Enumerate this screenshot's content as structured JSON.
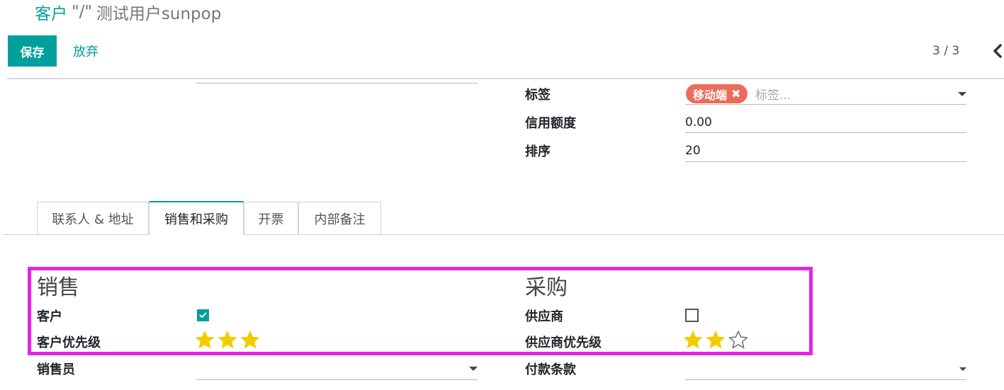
{
  "breadcrumb": {
    "parent": "客户",
    "separator": "\"/\"",
    "current": "测试用户sunpop"
  },
  "toolbar": {
    "save_label": "保存",
    "discard_label": "放弃"
  },
  "pager": {
    "value": "3 / 3"
  },
  "fields": {
    "tags": {
      "label": "标签",
      "badge": "移动端",
      "placeholder": "标签..."
    },
    "credit_limit": {
      "label": "信用额度",
      "value": "0.00"
    },
    "sequence": {
      "label": "排序",
      "value": "20"
    }
  },
  "tabs": [
    {
      "label": "联系人 & 地址"
    },
    {
      "label": "销售和采购"
    },
    {
      "label": "开票"
    },
    {
      "label": "内部备注"
    }
  ],
  "sales": {
    "title": "销售",
    "customer_label": "客户",
    "customer_checked": true,
    "priority_label": "客户优先级",
    "priority_value": 3,
    "priority_max": 3,
    "salesperson_label": "销售员"
  },
  "purchase": {
    "title": "采购",
    "supplier_label": "供应商",
    "supplier_checked": false,
    "priority_label": "供应商优先级",
    "priority_value": 2,
    "priority_max": 3,
    "payment_terms_label": "付款条款"
  },
  "colors": {
    "accent": "#00a09d",
    "tag": "#ec6c5b",
    "star": "#f3cc00",
    "highlight": "#e524e5"
  }
}
